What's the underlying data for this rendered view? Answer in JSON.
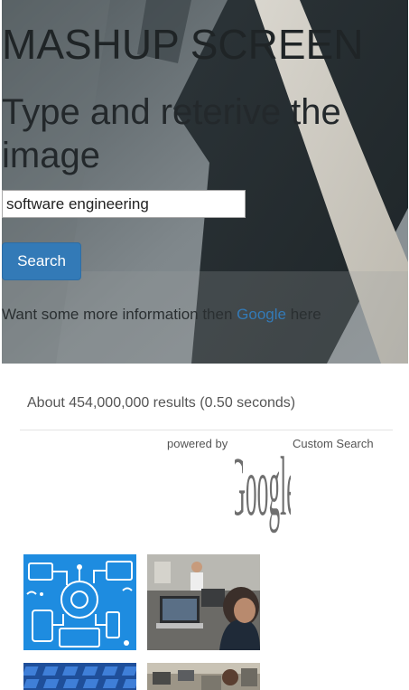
{
  "hero": {
    "title": "MASHUP SCREEN",
    "subtitle": "Type and reterive the image",
    "search_value": "software engineering",
    "search_button_label": "Search",
    "info_prefix": "Want some more information then ",
    "info_link": "Google",
    "info_suffix": " here"
  },
  "results": {
    "stats": "About 454,000,000 results (0.50 seconds)",
    "powered_by": "powered by",
    "google_logo_text": "Google",
    "custom_search": "Custom Search"
  },
  "colors": {
    "button": "#337ab7",
    "link": "#337ab7"
  },
  "icons": {
    "thumbnail_1": "software-engineering-circuit-illustration",
    "thumbnail_2": "developer-at-laptop-photo",
    "thumbnail_3": "blue-keyboard-photo",
    "thumbnail_4": "office-workers-photo"
  }
}
